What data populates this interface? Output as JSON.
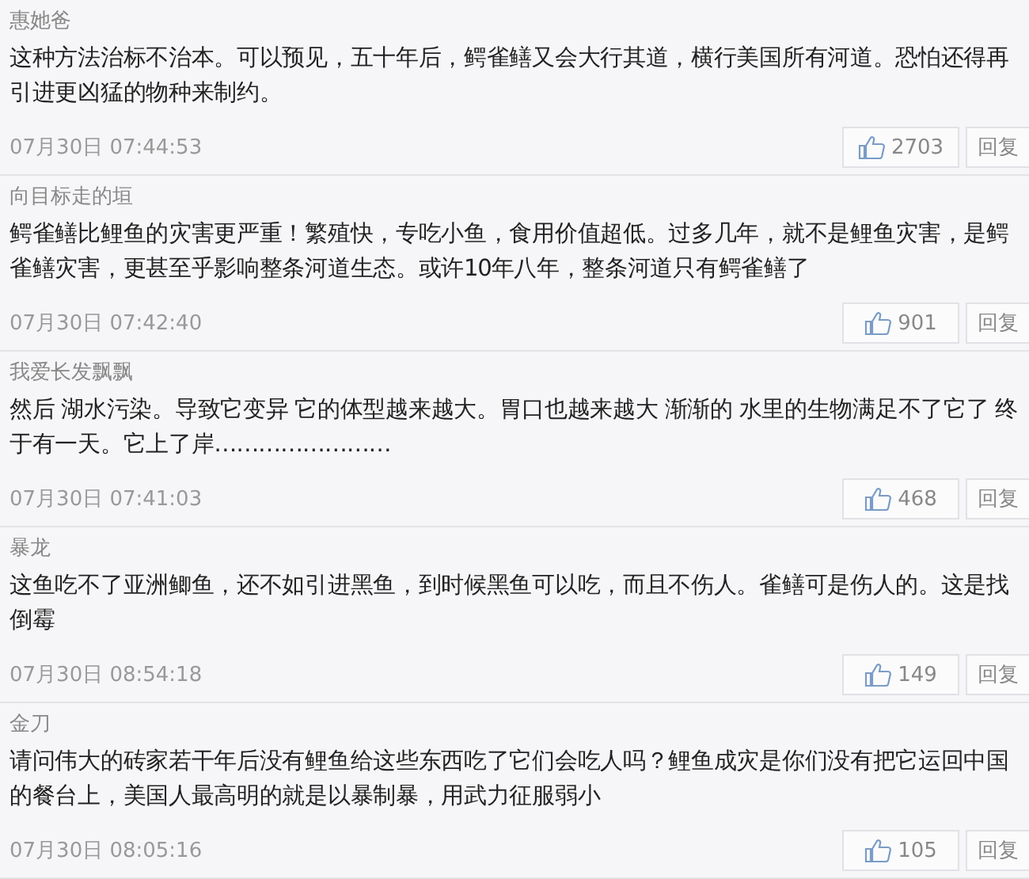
{
  "comments": [
    {
      "author": "惠她爸",
      "text": "这种方法治标不治本。可以预见，五十年后，鳄雀鳝又会大行其道，横行美国所有河道。恐怕还得再引进更凶猛的物种来制约。",
      "time": "07月30日 07:44:53",
      "likes": "2703",
      "reply": "回复"
    },
    {
      "author": "向目标走的垣",
      "text": "鳄雀鳝比鲤鱼的灾害更严重！繁殖快，专吃小鱼，食用价值超低。过多几年，就不是鲤鱼灾害，是鳄雀鳝灾害，更甚至乎影响整条河道生态。或许10年八年，整条河道只有鳄雀鳝了",
      "time": "07月30日 07:42:40",
      "likes": "901",
      "reply": "回复"
    },
    {
      "author": "我爱长发飘飘",
      "text": "然后 湖水污染。导致它变异 它的体型越来越大。胃口也越来越大 渐渐的 水里的生物满足不了它了 终于有一天。它上了岸……………………",
      "time": "07月30日 07:41:03",
      "likes": "468",
      "reply": "回复"
    },
    {
      "author": "暴龙",
      "text": "这鱼吃不了亚洲鲫鱼，还不如引进黑鱼，到时候黑鱼可以吃，而且不伤人。雀鳝可是伤人的。这是找倒霉",
      "time": "07月30日 08:54:18",
      "likes": "149",
      "reply": "回复"
    },
    {
      "author": "金刀",
      "text": "请问伟大的砖家若干年后没有鲤鱼给这些东西吃了它们会吃人吗？鲤鱼成灾是你们没有把它运回中国的餐台上，美国人最高明的就是以暴制暴，用武力征服弱小",
      "time": "07月30日 08:05:16",
      "likes": "105",
      "reply": "回复"
    }
  ]
}
